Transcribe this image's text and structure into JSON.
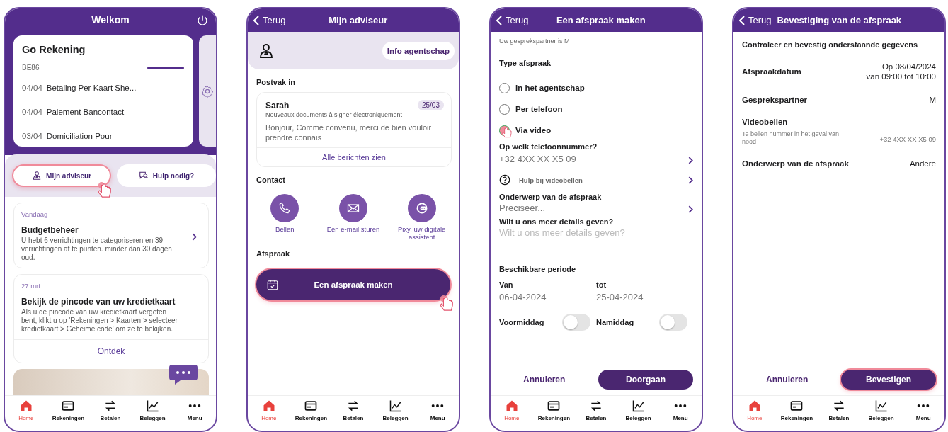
{
  "home": {
    "header": {
      "title": "Welkom"
    },
    "account": {
      "title": "Go Rekening",
      "iban": "BE86",
      "transactions": [
        {
          "date": "04/04",
          "description": "Betaling Per Kaart She..."
        },
        {
          "date": "04/04",
          "description": "Paiement Bancontact"
        },
        {
          "date": "03/04",
          "description": "Domiciliation Pour"
        }
      ]
    },
    "quick_actions": [
      {
        "label": "Mijn adviseur",
        "pressed": true
      },
      {
        "label": "Hulp nodig?",
        "pressed": false
      }
    ],
    "cards": [
      {
        "kind": "chevron",
        "date": "Vandaag",
        "title": "Budgetbeheer",
        "text": "U hebt 6 verrichtingen te categoriseren en 39 verrichtingen af te punten. minder dan 30 dagen oud."
      },
      {
        "kind": "action",
        "date": "27 mrt",
        "title": "Bekijk de pincode van uw kredietkaart",
        "text": "Als u de pincode van uw kredietkaart vergeten bent, klikt u op 'Rekeningen > Kaarten > selecteer kredietkaart > Geheime code' om ze te bekijken.",
        "action": "Ontdek"
      }
    ],
    "tab_bar": [
      {
        "label": "Home",
        "selected": true
      },
      {
        "label": "Rekeningen",
        "selected": false
      },
      {
        "label": "Betalen",
        "selected": false
      },
      {
        "label": "Beleggen",
        "selected": false
      },
      {
        "label": "Menu",
        "selected": false
      }
    ]
  },
  "advisor": {
    "header": {
      "back": "Terug",
      "title": "Mijn adviseur"
    },
    "info_button": "Info agentschap",
    "inbox": {
      "heading": "Postvak in",
      "sender": "Sarah",
      "date": "25/03",
      "subject": "Nouveaux documents à signer électroniquement",
      "preview": "Bonjour, Comme convenu, merci de bien vouloir prendre connais",
      "link": "Alle berichten zien"
    },
    "contact": {
      "heading": "Contact",
      "actions": [
        {
          "kind": "phone",
          "label": "Bellen"
        },
        {
          "kind": "email",
          "label": "Een e-mail sturen"
        },
        {
          "kind": "assistant",
          "label": "Pixy, uw digitale assistent"
        }
      ]
    },
    "appointment": {
      "heading": "Afspraak",
      "button": "Een afspraak maken",
      "pressed": true
    },
    "tab_bar": [
      {
        "label": "Home",
        "selected": true
      },
      {
        "label": "Rekeningen",
        "selected": false
      },
      {
        "label": "Betalen",
        "selected": false
      },
      {
        "label": "Beleggen",
        "selected": false
      },
      {
        "label": "Menu",
        "selected": false
      }
    ]
  },
  "appointment": {
    "header": {
      "back": "Terug",
      "title": "Een afspraak maken"
    },
    "partner_note": "Uw gesprekspartner is M",
    "type": {
      "heading": "Type afspraak",
      "options": [
        {
          "label": "In het agentschap",
          "selected": false
        },
        {
          "label": "Per telefoon",
          "selected": false
        },
        {
          "label": "Via video",
          "selected": true
        }
      ]
    },
    "phone": {
      "label": "Op welk telefoonnummer?",
      "value": "+32 4XX XX X5 09"
    },
    "help": {
      "label": "Hulp bij videobellen"
    },
    "subject": {
      "label": "Onderwerp van de afspraak",
      "placeholder": "Preciseer..."
    },
    "details": {
      "label": "Wilt u ons meer details geven?",
      "placeholder": "Wilt u ons meer details geven?"
    },
    "period": {
      "heading": "Beschikbare periode",
      "from": {
        "label": "Van",
        "value": "06-04-2024"
      },
      "to": {
        "label": "tot",
        "value": "25-04-2024"
      }
    },
    "toggles": [
      {
        "label": "Voormiddag",
        "on": false
      },
      {
        "label": "Namiddag",
        "on": false
      }
    ],
    "cancel": "Annuleren",
    "submit": {
      "label": "Doorgaan",
      "pressed": false
    },
    "tab_bar": [
      {
        "label": "Home",
        "selected": true
      },
      {
        "label": "Rekeningen",
        "selected": false
      },
      {
        "label": "Betalen",
        "selected": false
      },
      {
        "label": "Beleggen",
        "selected": false
      },
      {
        "label": "Menu",
        "selected": false
      }
    ]
  },
  "confirmation": {
    "header": {
      "back": "Terug",
      "title": "Bevestiging van de afspraak"
    },
    "heading": "Controleer en bevestig onderstaande gegevens",
    "rows": [
      {
        "label": "Afspraakdatum",
        "values": [
          "Op 08/04/2024",
          "van 09:00 tot 10:00"
        ]
      },
      {
        "label": "Gesprekspartner",
        "values": [
          "M"
        ]
      },
      {
        "label": "Videobellen",
        "note": "Te bellen nummer in het geval van nood",
        "values": [
          "+32 4XX XX X5 09"
        ]
      },
      {
        "label": "Onderwerp van de afspraak",
        "values": [
          "Andere"
        ]
      }
    ],
    "cancel": "Annuleren",
    "submit": {
      "label": "Bevestigen",
      "pressed": true
    },
    "tab_bar": [
      {
        "label": "Home",
        "selected": true
      },
      {
        "label": "Rekeningen",
        "selected": false
      },
      {
        "label": "Betalen",
        "selected": false
      },
      {
        "label": "Beleggen",
        "selected": false
      },
      {
        "label": "Menu",
        "selected": false
      }
    ]
  }
}
